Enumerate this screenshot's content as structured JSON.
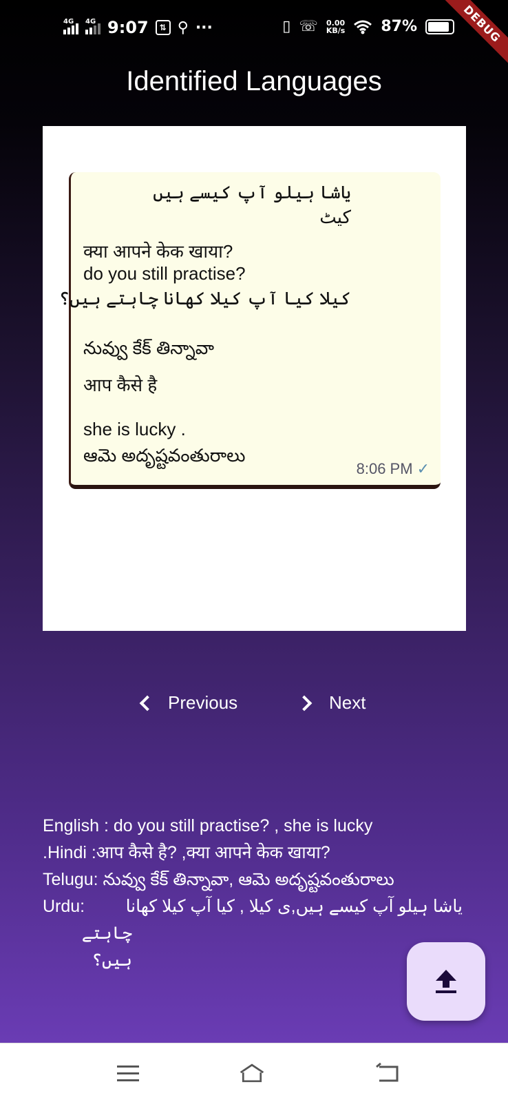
{
  "status_bar": {
    "network_1": "4G",
    "network_2": "4G",
    "time": "9:07",
    "data_speed_value": "0.00",
    "data_speed_unit": "KB/s",
    "battery": "87%",
    "debug_banner": "DEBUG"
  },
  "app_bar": {
    "title": "Identified Languages"
  },
  "image_preview": {
    "lines": [
      "یاشا ہیلو آپ کیسے ہیں",
      "کیٹ",
      "क्या आपने केक खाया?",
      "do you still practise?",
      "کیلا   کیا آپ کیلا کھانا چاہتے ہیں؟",
      "నువ్వు కేక్ తిన్నావా",
      "आप कैसे है",
      "she is lucky .",
      "ఆమె అదృష్టవంతురాలు"
    ],
    "timestamp": "8:06 PM",
    "check_icon": "✓"
  },
  "navigation": {
    "previous_label": "Previous",
    "next_label": "Next"
  },
  "results": {
    "english": "English : do you still practise? , she is lucky",
    "hindi": ".Hindi :आप कैसे है? ,क्या आपने केक खाया?",
    "telugu": "Telugu: నువ్వు కేక్ తిన్నావా, ఆమె అదృష్టవంతురాలు",
    "urdu_label": "Urdu:",
    "urdu_text": "یاشا ہیلو آپ کیسے ہیں,ی کیلا ,  کیا آپ کیلا کھانا",
    "urdu_text_2": "چاہتے ہیں؟"
  },
  "fab": {
    "icon": "upload-icon"
  }
}
